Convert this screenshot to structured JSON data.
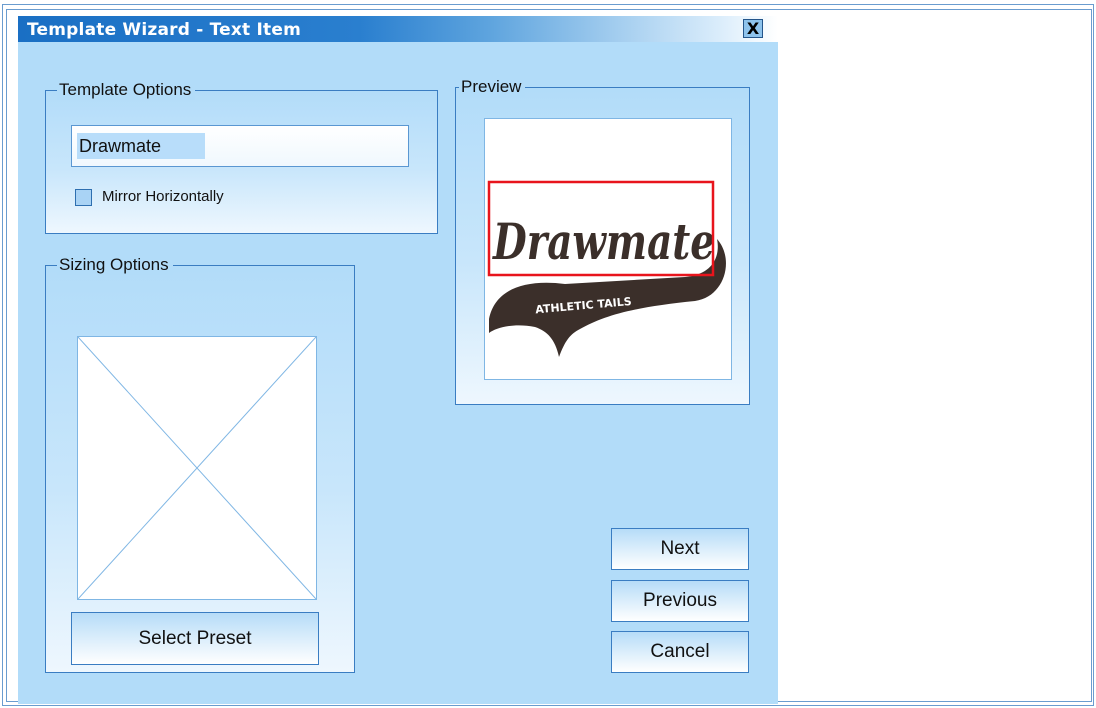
{
  "window": {
    "title": "Template Wizard - Text Item",
    "close_glyph": "X"
  },
  "template_options": {
    "legend": "Template Options",
    "text_value": "Drawmate",
    "mirror_label": "Mirror Horizontally",
    "mirror_checked": false
  },
  "sizing_options": {
    "legend": "Sizing Options",
    "select_preset_label": "Select Preset"
  },
  "preview": {
    "legend": "Preview",
    "logo_main": "Drawmate",
    "logo_sub": "ATHLETIC TAILS"
  },
  "buttons": {
    "next": "Next",
    "previous": "Previous",
    "cancel": "Cancel"
  },
  "colors": {
    "accent": "#1a6fc4",
    "window_bg": "#b2dcf9",
    "selection_box": "#e8141c",
    "logo_ink": "#3b2f2a"
  }
}
